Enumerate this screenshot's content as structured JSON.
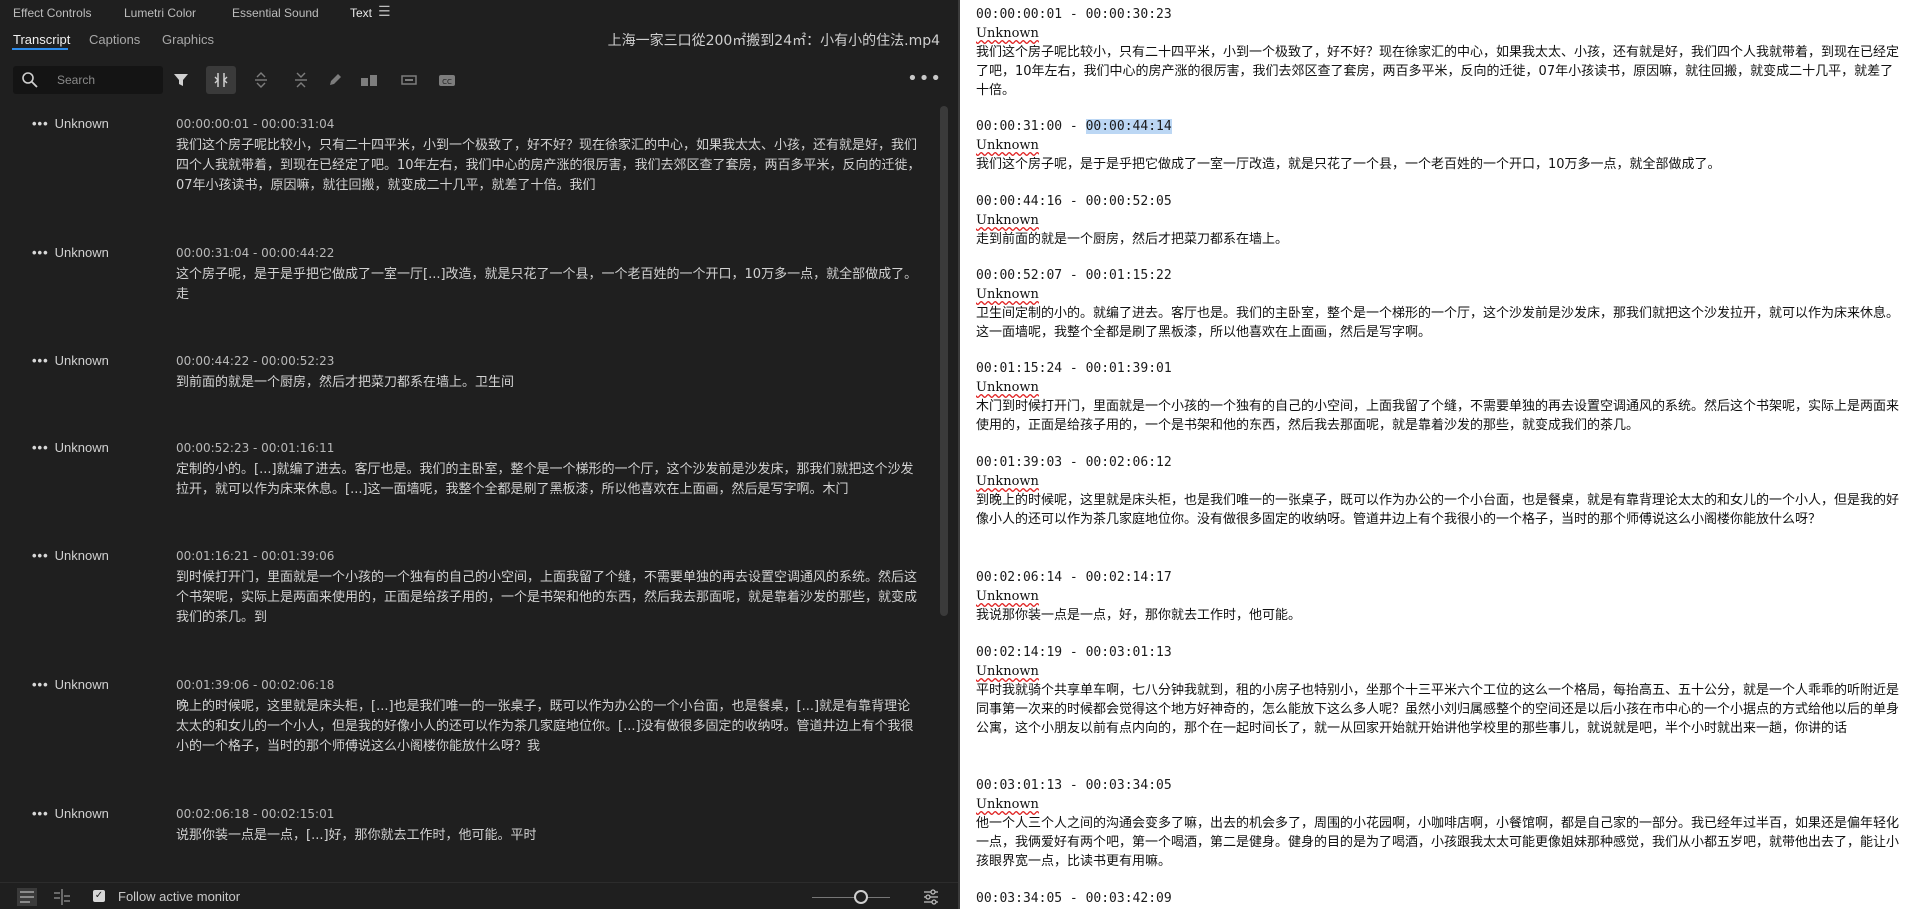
{
  "panel_tabs": [
    "Effect Controls",
    "Lumetri Color",
    "Essential Sound",
    "Text"
  ],
  "sub_tabs": [
    "Transcript",
    "Captions",
    "Graphics"
  ],
  "file_title": "上海一家三口從200㎡搬到24㎡：小有小的住法.mp4",
  "search": {
    "placeholder": "Search"
  },
  "more_label": "•••",
  "entry_menu": "•••",
  "transcript_entries": [
    {
      "speaker": "Unknown",
      "timecode": "00:00:00:01 - 00:00:31:04",
      "text": "我们这个房子呢比较小，只有二十四平米，小到一个极致了，好不好？现在徐家汇的中心，如果我太太、小孩，还有就是好，我们四个人我就带着，到现在已经定了吧。10年左右，我们中心的房产涨的很厉害，我们去郊区查了套房，两百多平米，反向的迁徙，07年小孩读书，原因嘛，就往回搬，就变成二十几平，就差了十倍。我们"
    },
    {
      "speaker": "Unknown",
      "timecode": "00:00:31:04 - 00:00:44:22",
      "text": "这个房子呢，是于是乎把它做成了一室一厅[...]改造，就是只花了一个县，一个老百姓的一个开口，10万多一点，就全部做成了。走"
    },
    {
      "speaker": "Unknown",
      "timecode": "00:00:44:22 - 00:00:52:23",
      "text": "到前面的就是一个厨房，然后才把菜刀都系在墙上。卫生间"
    },
    {
      "speaker": "Unknown",
      "timecode": "00:00:52:23 - 00:01:16:11",
      "text": "定制的小的。[...]就编了进去。客厅也是。我们的主卧室，整个是一个梯形的一个厅，这个沙发前是沙发床，那我们就把这个沙发拉开，就可以作为床来休息。[...]这一面墙呢，我整个全都是刷了黑板漆，所以他喜欢在上面画，然后是写字啊。木门"
    },
    {
      "speaker": "Unknown",
      "timecode": "00:01:16:21 - 00:01:39:06",
      "text": "到时候打开门，里面就是一个小孩的一个独有的自己的小空间，上面我留了个缝，不需要单独的再去设置空调通风的系统。然后这个书架呢，实际上是两面来使用的，正面是给孩子用的，一个是书架和他的东西，然后我去那面呢，就是靠着沙发的那些，就变成我们的茶几。到"
    },
    {
      "speaker": "Unknown",
      "timecode": "00:01:39:06 - 00:02:06:18",
      "text": "晚上的时候呢，这里就是床头柜，[...]也是我们唯一的一张桌子，既可以作为办公的一个小台面，也是餐桌，[...]就是有靠背理论太太的和女儿的一个小人，但是我的好像小人的还可以作为茶几家庭地位你。[...]没有做很多固定的收纳呀。管道井边上有个我很小的一个格子，当时的那个师傅说这么小阁楼你能放什么呀？我"
    },
    {
      "speaker": "Unknown",
      "timecode": "00:02:06:18 - 00:02:15:01",
      "text": "说那你装一点是一点，[...]好，那你就去工作时，他可能。平时"
    }
  ],
  "follow_label": "Follow active monitor",
  "subtitle_blocks": [
    {
      "tc_start": "00:00:00:01",
      "tc_sep": " - ",
      "tc_end": "00:00:30:23",
      "speaker": "Unknown",
      "text": "我们这个房子呢比较小，只有二十四平米，小到一个极致了，好不好？现在徐家汇的中心，如果我太太、小孩，还有就是好，我们四个人我就带着，到现在已经定了吧，10年左右，我们中心的房产涨的很厉害，我们去郊区查了套房，两百多平米，反向的迁徙，07年小孩读书，原因嘛，就往回搬，就变成二十几平，就差了十倍。"
    },
    {
      "tc_start": "00:00:31:00",
      "tc_sep": " - ",
      "tc_end": "00:00:44:14",
      "speaker": "Unknown",
      "text": "我们这个房子呢，是于是乎把它做成了一室一厅改造，就是只花了一个县，一个老百姓的一个开口，10万多一点，就全部做成了。"
    },
    {
      "tc_start": "00:00:44:16",
      "tc_sep": " - ",
      "tc_end": "00:00:52:05",
      "speaker": "Unknown",
      "text": "走到前面的就是一个厨房，然后才把菜刀都系在墙上。"
    },
    {
      "tc_start": "00:00:52:07",
      "tc_sep": " - ",
      "tc_end": "00:01:15:22",
      "speaker": "Unknown",
      "text": "卫生间定制的小的。就编了进去。客厅也是。我们的主卧室，整个是一个梯形的一个厅，这个沙发前是沙发床，那我们就把这个沙发拉开，就可以作为床来休息。这一面墙呢，我整个全都是刷了黑板漆，所以他喜欢在上面画，然后是写字啊。"
    },
    {
      "tc_start": "00:01:15:24",
      "tc_sep": " - ",
      "tc_end": "00:01:39:01",
      "speaker": "Unknown",
      "text": "木门到时候打开门，里面就是一个小孩的一个独有的自己的小空间，上面我留了个缝，不需要单独的再去设置空调通风的系统。然后这个书架呢，实际上是两面来使用的，正面是给孩子用的，一个是书架和他的东西，然后我去那面呢，就是靠着沙发的那些，就变成我们的茶几。"
    },
    {
      "tc_start": "00:01:39:03",
      "tc_sep": " - ",
      "tc_end": "00:02:06:12",
      "speaker": "Unknown",
      "text": "到晚上的时候呢，这里就是床头柜，也是我们唯一的一张桌子，既可以作为办公的一个小台面，也是餐桌，就是有靠背理论太太的和女儿的一个小人，但是我的好像小人的还可以作为茶几家庭地位你。没有做很多固定的收纳呀。管道井边上有个我很小的一个格子，当时的那个师傅说这么小阁楼你能放什么呀？"
    },
    {
      "tc_start": "00:02:06:14",
      "tc_sep": " - ",
      "tc_end": "00:02:14:17",
      "speaker": "Unknown",
      "text": "我说那你装一点是一点，好，那你就去工作时，他可能。"
    },
    {
      "tc_start": "00:02:14:19",
      "tc_sep": " - ",
      "tc_end": "00:03:01:13",
      "speaker": "Unknown",
      "text": "平时我就骑个共享单车啊，七八分钟我就到，租的小房子也特别小，坐那个十三平米六个工位的这么一个格局，每抬高五、五十公分，就是一个人乖乖的听附近是同事第一次来的时候都会觉得这个地方好神奇的，怎么能放下这么多人呢？虽然小刘归属感整个的空间还是以后小孩在市中心的一个小据点的方式给他以后的单身公寓，这个小朋友以前有点内向的，那个在一起时间长了，就一从回家开始就开始讲他学校里的那些事儿，就说就是吧，半个小时就出来一趟，你讲的话"
    },
    {
      "tc_start": "00:03:01:13",
      "tc_sep": " - ",
      "tc_end": "00:03:34:05",
      "speaker": "Unknown",
      "text": "他一个人三个人之间的沟通会变多了嘛，出去的机会多了，周围的小花园啊，小咖啡店啊，小餐馆啊，都是自己家的一部分。我已经年过半百，如果还是偏年轻化一点，我俩爱好有两个吧，第一个喝酒，第二是健身。健身的目的是为了喝酒，小孩跟我太太可能更像姐妹那种感觉，我们从小都五岁吧，就带他出去了，能让小孩眼界宽一点，比读书更有用嘛。"
    },
    {
      "tc_start": "00:03:34:05",
      "tc_sep": " - ",
      "tc_end": "00:03:42:09",
      "speaker": "",
      "text": ""
    }
  ]
}
